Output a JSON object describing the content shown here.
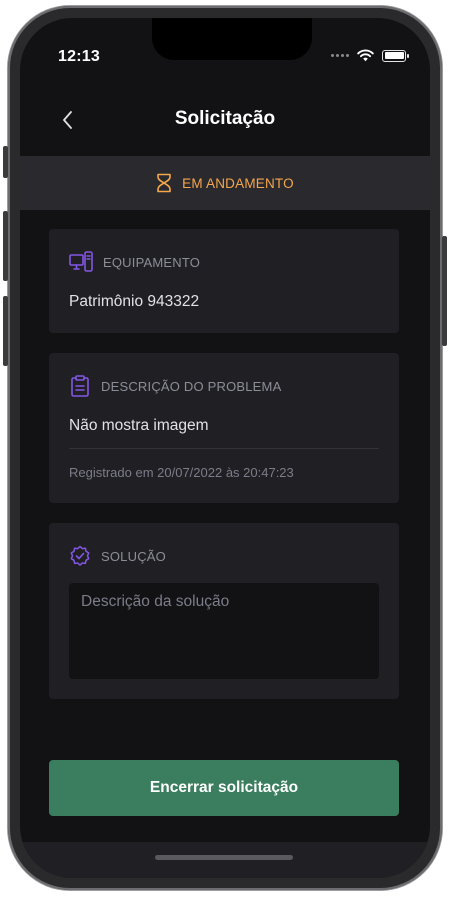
{
  "status_bar": {
    "time": "12:13"
  },
  "header": {
    "title": "Solicitação"
  },
  "status": {
    "label": "EM ANDAMENTO",
    "color": "#f5a74c"
  },
  "equipment": {
    "label": "EQUIPAMENTO",
    "value": "Patrimônio 943322"
  },
  "problem": {
    "label": "DESCRIÇÃO DO PROBLEMA",
    "value": "Não mostra imagem",
    "registered": "Registrado em 20/07/2022 às 20:47:23"
  },
  "solution": {
    "label": "SOLUÇÃO",
    "placeholder": "Descrição da solução"
  },
  "actions": {
    "close_label": "Encerrar solicitação"
  },
  "colors": {
    "accent": "#8257e5",
    "primary": "#3a7d5f",
    "background": "#121214",
    "card": "#202024"
  },
  "icons": {
    "back": "chevron-left-icon",
    "status": "hourglass-icon",
    "equipment": "desktop-mobile-icon",
    "problem": "clipboard-icon",
    "solution": "seal-check-icon"
  }
}
